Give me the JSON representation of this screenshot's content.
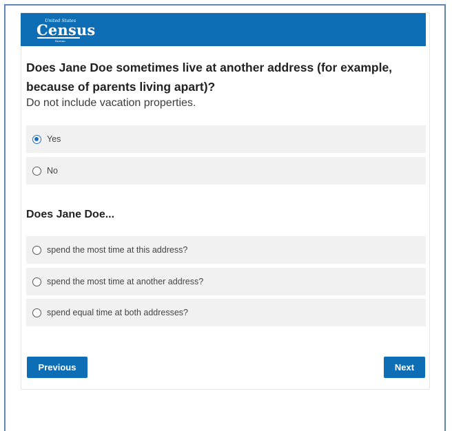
{
  "header": {
    "logo_top": "United States",
    "logo_main": "Census",
    "logo_bottom": "Bureau",
    "brand_color": "#0e6eb5"
  },
  "question": {
    "title": "Does Jane Doe sometimes live at another address (for example, because of parents living apart)?",
    "hint": "Do not include vacation properties.",
    "options": [
      {
        "label": "Yes",
        "selected": true
      },
      {
        "label": "No",
        "selected": false
      }
    ]
  },
  "followup": {
    "title": "Does Jane Doe...",
    "options": [
      {
        "label": "spend the most time at this address?",
        "selected": false
      },
      {
        "label": "spend the most time at another address?",
        "selected": false
      },
      {
        "label": "spend equal time at both addresses?",
        "selected": false
      }
    ]
  },
  "navigation": {
    "previous_label": "Previous",
    "next_label": "Next"
  }
}
